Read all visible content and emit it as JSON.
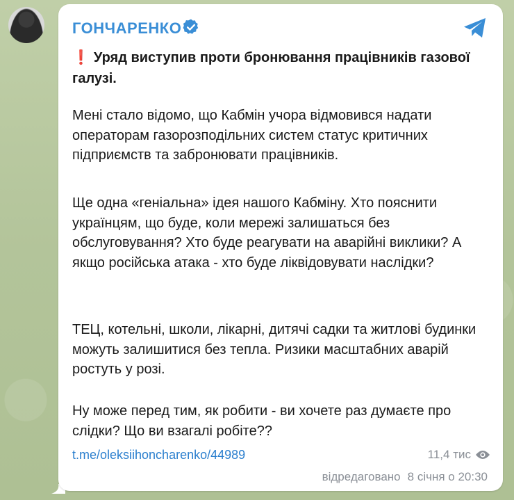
{
  "channel": {
    "name": "ГОНЧАРЕНКО",
    "verified": true,
    "accent_color": "#3a8ed6"
  },
  "post": {
    "headline_icon": "❗",
    "headline": "Уряд виступив проти бронювання працівників газової галузі.",
    "paragraphs": [
      "Мені стало відомо, що Кабмін учора відмовився надати операторам газорозподільних систем статус критичних підприємств та забронювати працівників.",
      "Ще одна «геніальна» ідея нашого Кабміну. Хто пояснити українцям, що буде, коли мережі залишаться без обслуговування? Хто буде реагувати на аварійні виклики? А якщо російська атака - хто буде ліквідовувати наслідки?",
      "ТЕЦ, котельні, школи, лікарні, дитячі садки та житлові будинки можуть залишитися без тепла. Ризики масштабних аварій ростуть у розі.",
      "Ну може перед тим, як робити - ви хочете раз думаєте про слідки? Що ви взагалі робіте??"
    ],
    "link": "t.me/oleksiihoncharenko/44989",
    "views": "11,4 тис",
    "edited_label": "відредаговано",
    "date_time": "8 січня о 20:30"
  },
  "icons": {
    "verified": "verified-badge-icon",
    "share": "share-icon",
    "views": "eye-icon"
  }
}
